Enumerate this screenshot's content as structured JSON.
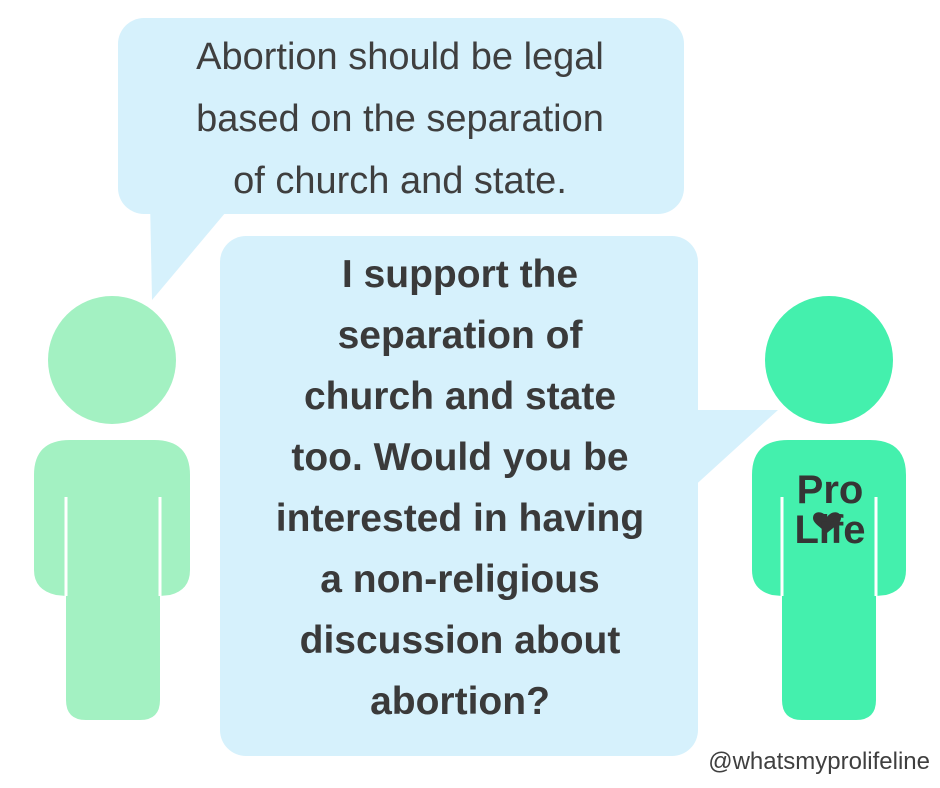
{
  "left_speech": {
    "lines": [
      "Abortion should be legal",
      "based on the separation",
      "of church and state."
    ]
  },
  "right_speech": {
    "lines": [
      "I support the",
      "separation of",
      "church and state",
      "too. Would you be",
      "interested in having",
      "a non-religious",
      "discussion about",
      "abortion?"
    ]
  },
  "shirt_text": {
    "line1": "Pro",
    "line2": "Life"
  },
  "handle": "@whatsmyprolifeline",
  "colors": {
    "bubble": "#d6f1fc",
    "left_person": "#a3f1c2",
    "right_person": "#44f0ad",
    "text": "#3b3b3b"
  },
  "icons": {
    "left_person": "person-icon",
    "right_person": "person-icon",
    "heart": "heart-icon"
  }
}
